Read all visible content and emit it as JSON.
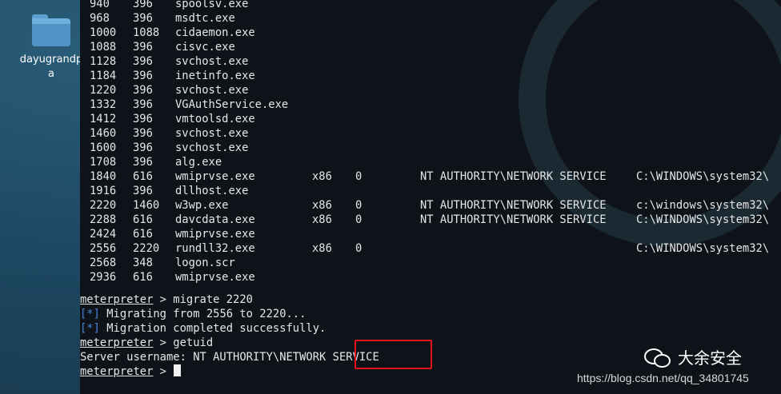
{
  "desktop": {
    "icon": {
      "label": "dayugrandpa"
    }
  },
  "processes": [
    {
      "pid": "940",
      "ppid": "396",
      "name": "spoolsv.exe",
      "arch": "",
      "session": "",
      "user": "",
      "path": ""
    },
    {
      "pid": "968",
      "ppid": "396",
      "name": "msdtc.exe",
      "arch": "",
      "session": "",
      "user": "",
      "path": ""
    },
    {
      "pid": "1000",
      "ppid": "1088",
      "name": "cidaemon.exe",
      "arch": "",
      "session": "",
      "user": "",
      "path": ""
    },
    {
      "pid": "1088",
      "ppid": "396",
      "name": "cisvc.exe",
      "arch": "",
      "session": "",
      "user": "",
      "path": ""
    },
    {
      "pid": "1128",
      "ppid": "396",
      "name": "svchost.exe",
      "arch": "",
      "session": "",
      "user": "",
      "path": ""
    },
    {
      "pid": "1184",
      "ppid": "396",
      "name": "inetinfo.exe",
      "arch": "",
      "session": "",
      "user": "",
      "path": ""
    },
    {
      "pid": "1220",
      "ppid": "396",
      "name": "svchost.exe",
      "arch": "",
      "session": "",
      "user": "",
      "path": ""
    },
    {
      "pid": "1332",
      "ppid": "396",
      "name": "VGAuthService.exe",
      "arch": "",
      "session": "",
      "user": "",
      "path": ""
    },
    {
      "pid": "1412",
      "ppid": "396",
      "name": "vmtoolsd.exe",
      "arch": "",
      "session": "",
      "user": "",
      "path": ""
    },
    {
      "pid": "1460",
      "ppid": "396",
      "name": "svchost.exe",
      "arch": "",
      "session": "",
      "user": "",
      "path": ""
    },
    {
      "pid": "1600",
      "ppid": "396",
      "name": "svchost.exe",
      "arch": "",
      "session": "",
      "user": "",
      "path": ""
    },
    {
      "pid": "1708",
      "ppid": "396",
      "name": "alg.exe",
      "arch": "",
      "session": "",
      "user": "",
      "path": ""
    },
    {
      "pid": "1840",
      "ppid": "616",
      "name": "wmiprvse.exe",
      "arch": "x86",
      "session": "0",
      "user": "NT AUTHORITY\\NETWORK SERVICE",
      "path": "C:\\WINDOWS\\system32\\"
    },
    {
      "pid": "1916",
      "ppid": "396",
      "name": "dllhost.exe",
      "arch": "",
      "session": "",
      "user": "",
      "path": ""
    },
    {
      "pid": "2220",
      "ppid": "1460",
      "name": "w3wp.exe",
      "arch": "x86",
      "session": "0",
      "user": "NT AUTHORITY\\NETWORK SERVICE",
      "path": "c:\\windows\\system32\\"
    },
    {
      "pid": "2288",
      "ppid": "616",
      "name": "davcdata.exe",
      "arch": "x86",
      "session": "0",
      "user": "NT AUTHORITY\\NETWORK SERVICE",
      "path": "C:\\WINDOWS\\system32\\"
    },
    {
      "pid": "2424",
      "ppid": "616",
      "name": "wmiprvse.exe",
      "arch": "",
      "session": "",
      "user": "",
      "path": ""
    },
    {
      "pid": "2556",
      "ppid": "2220",
      "name": "rundll32.exe",
      "arch": "x86",
      "session": "0",
      "user": "",
      "path": "C:\\WINDOWS\\system32\\"
    },
    {
      "pid": "2568",
      "ppid": "348",
      "name": "logon.scr",
      "arch": "",
      "session": "",
      "user": "",
      "path": ""
    },
    {
      "pid": "2936",
      "ppid": "616",
      "name": "wmiprvse.exe",
      "arch": "",
      "session": "",
      "user": "",
      "path": ""
    }
  ],
  "session": {
    "prompt": "meterpreter",
    "prompt_sep": " > ",
    "cmd_migrate": "migrate 2220",
    "star": "[*]",
    "msg_migrating": " Migrating from 2556 to 2220...",
    "msg_completed": " Migration completed successfully.",
    "cmd_getuid": "getuid",
    "server_username": "Server username: NT AUTHORITY\\NETWORK SERVICE"
  },
  "watermark": {
    "brand": "大余安全",
    "url": "https://blog.csdn.net/qq_34801745"
  },
  "colors": {
    "terminal_bg": "#0d1318",
    "highlight_box": "#e3141a",
    "info_star": "#4b84d9"
  }
}
